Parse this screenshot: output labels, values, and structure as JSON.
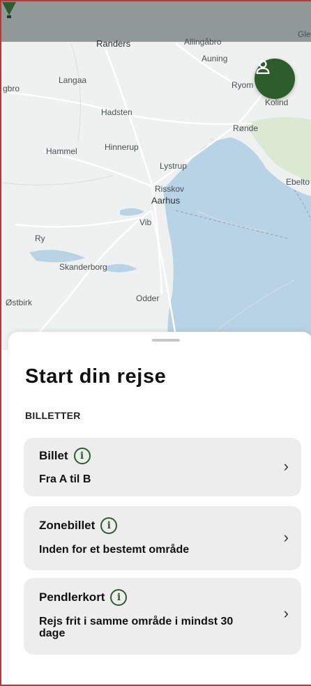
{
  "map": {
    "labels": {
      "randers": "Randers",
      "allingabro": "Allingåbro",
      "gle": "Gle",
      "auning": "Auning",
      "langaa": "Langaa",
      "gbro": "gbro",
      "ryom": "Ryom",
      "kolind": "Kolind",
      "hadsten": "Hadsten",
      "ronde": "Rønde",
      "hammel": "Hammel",
      "hinnerup": "Hinnerup",
      "lystrup": "Lystrup",
      "ebelto": "Ebelto",
      "risskov": "Risskov",
      "aarhus": "Aarhus",
      "viby": "Vib",
      "ry": "Ry",
      "skanderborg": "Skanderborg",
      "ostbirk": "Østbirk",
      "odder": "Odder"
    },
    "profile_icon": "user-icon",
    "pin_icon": "location-pin-icon"
  },
  "sheet": {
    "title": "Start din rejse",
    "section_label": "BILLETTER",
    "cards": [
      {
        "name": "Billet",
        "description": "Fra A til B",
        "info_icon": "info-icon",
        "chevron": "›"
      },
      {
        "name": "Zonebillet",
        "description": "Inden for et bestemt område",
        "info_icon": "info-icon",
        "chevron": "›"
      },
      {
        "name": "Pendlerkort",
        "description": "Rejs frit i samme område i mindst 30 dage",
        "info_icon": "info-icon",
        "chevron": "›"
      }
    ]
  },
  "colors": {
    "accent": "#2d5d2a",
    "card_bg": "#ededed",
    "water": "#b9d3e6"
  }
}
